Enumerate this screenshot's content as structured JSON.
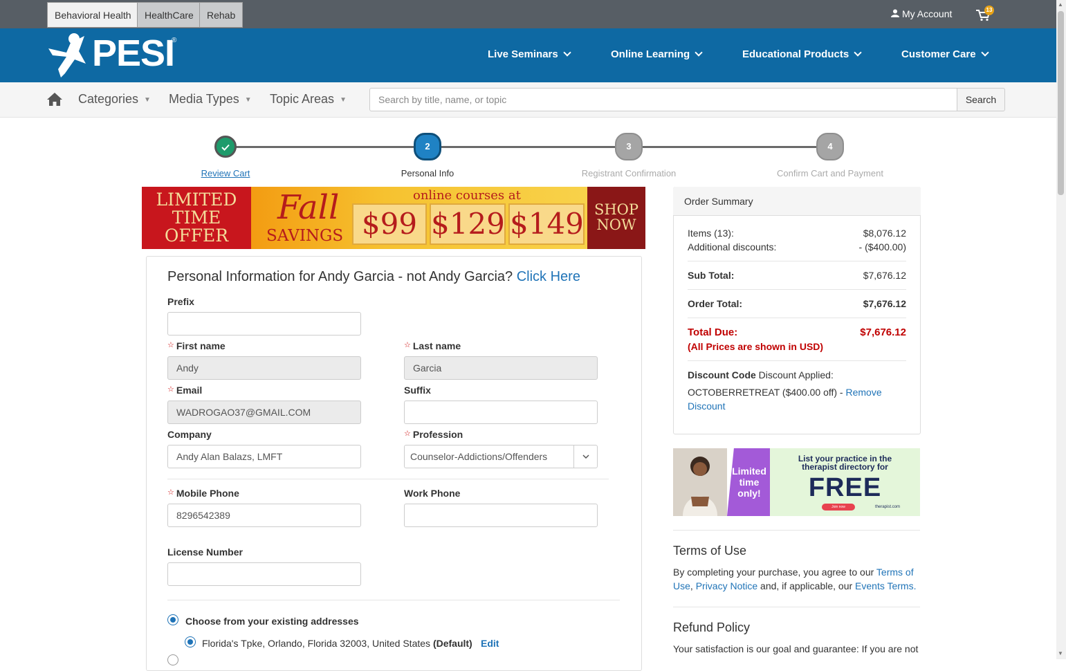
{
  "top_tabs": [
    "Behavioral Health",
    "HealthCare",
    "Rehab"
  ],
  "account": {
    "my_account": "My Account",
    "cart_count": "13"
  },
  "logo_text": "PESI",
  "nav": [
    "Live Seminars",
    "Online Learning",
    "Educational Products",
    "Customer Care"
  ],
  "subnav": {
    "categories": "Categories",
    "media_types": "Media Types",
    "topic_areas": "Topic Areas"
  },
  "search": {
    "placeholder": "Search by title, name, or topic",
    "button": "Search"
  },
  "steps": [
    {
      "number": "",
      "label": "Review Cart",
      "state": "done"
    },
    {
      "number": "2",
      "label": "Personal Info",
      "state": "current"
    },
    {
      "number": "3",
      "label": "Registrant Confirmation",
      "state": "todo"
    },
    {
      "number": "4",
      "label": "Confirm Cart and Payment",
      "state": "todo"
    }
  ],
  "promo": {
    "limited": [
      "LIMITED",
      "TIME",
      "OFFER"
    ],
    "fall": "Fall",
    "savings": "SAVINGS",
    "online_courses": "online courses at",
    "prices": [
      "$99",
      "$129",
      "$149"
    ],
    "shop": [
      "SHOP",
      "NOW"
    ]
  },
  "form": {
    "title_prefix": "Personal Information for Andy Garcia - not Andy Garcia?",
    "click_here": "Click Here",
    "prefix_label": "Prefix",
    "prefix_value": "",
    "first_name_label": "First name",
    "first_name_value": "Andy",
    "last_name_label": "Last name",
    "last_name_value": "Garcia",
    "email_label": "Email",
    "email_value": "WADROGAO37@GMAIL.COM",
    "suffix_label": "Suffix",
    "suffix_value": "",
    "company_label": "Company",
    "company_value": "Andy Alan Balazs, LMFT",
    "profession_label": "Profession",
    "profession_value": "Counselor-Addictions/Offenders",
    "mobile_label": "Mobile Phone",
    "mobile_value": "8296542389",
    "work_phone_label": "Work Phone",
    "work_phone_value": "",
    "license_label": "License Number",
    "license_value": "",
    "existing_addresses_label": "Choose from your existing addresses",
    "address_text": "Florida's Tpke, Orlando, Florida 32003, United States",
    "address_default": "(Default)",
    "edit_label": "Edit"
  },
  "summary": {
    "title": "Order Summary",
    "items_label": "Items (13):",
    "items_value": "$8,076.12",
    "discounts_label": "Additional discounts:",
    "discounts_value": "- ($400.00)",
    "subtotal_label": "Sub Total:",
    "subtotal_value": "$7,676.12",
    "order_total_label": "Order Total:",
    "order_total_value": "$7,676.12",
    "total_due_label": "Total Due:",
    "total_due_value": "$7,676.12",
    "usd_note": "(All Prices are shown in USD)",
    "discount_code_label": "Discount Code",
    "discount_applied": "Discount Applied:",
    "discount_code": "OCTOBERRETREAT ($400.00 off) -",
    "remove_link": "Remove",
    "discount_link": "Discount"
  },
  "promo2": {
    "limited": [
      "Limited",
      "time",
      "only!"
    ],
    "list_text": [
      "List your practice in the",
      "therapist directory for"
    ],
    "free": "FREE",
    "join": "Join now",
    "brand": "therapist.com"
  },
  "terms": {
    "heading": "Terms of Use",
    "p1": "By completing your purchase, you agree to our",
    "terms_link_1": "Terms of",
    "terms_link_2": "Use",
    "privacy_link": "Privacy Notice",
    "p2": "and, if applicable, our",
    "events_link": "Events Terms"
  },
  "refund": {
    "heading": "Refund Policy",
    "text": "Your satisfaction is our goal and guarantee: If you are not"
  },
  "colors": {
    "brand_blue": "#0e69a3",
    "topbar": "#575e65",
    "step_done": "#1e9b6b",
    "step_current": "#1f82c4",
    "step_todo": "#a5a5a5",
    "due_red": "#c00000"
  }
}
